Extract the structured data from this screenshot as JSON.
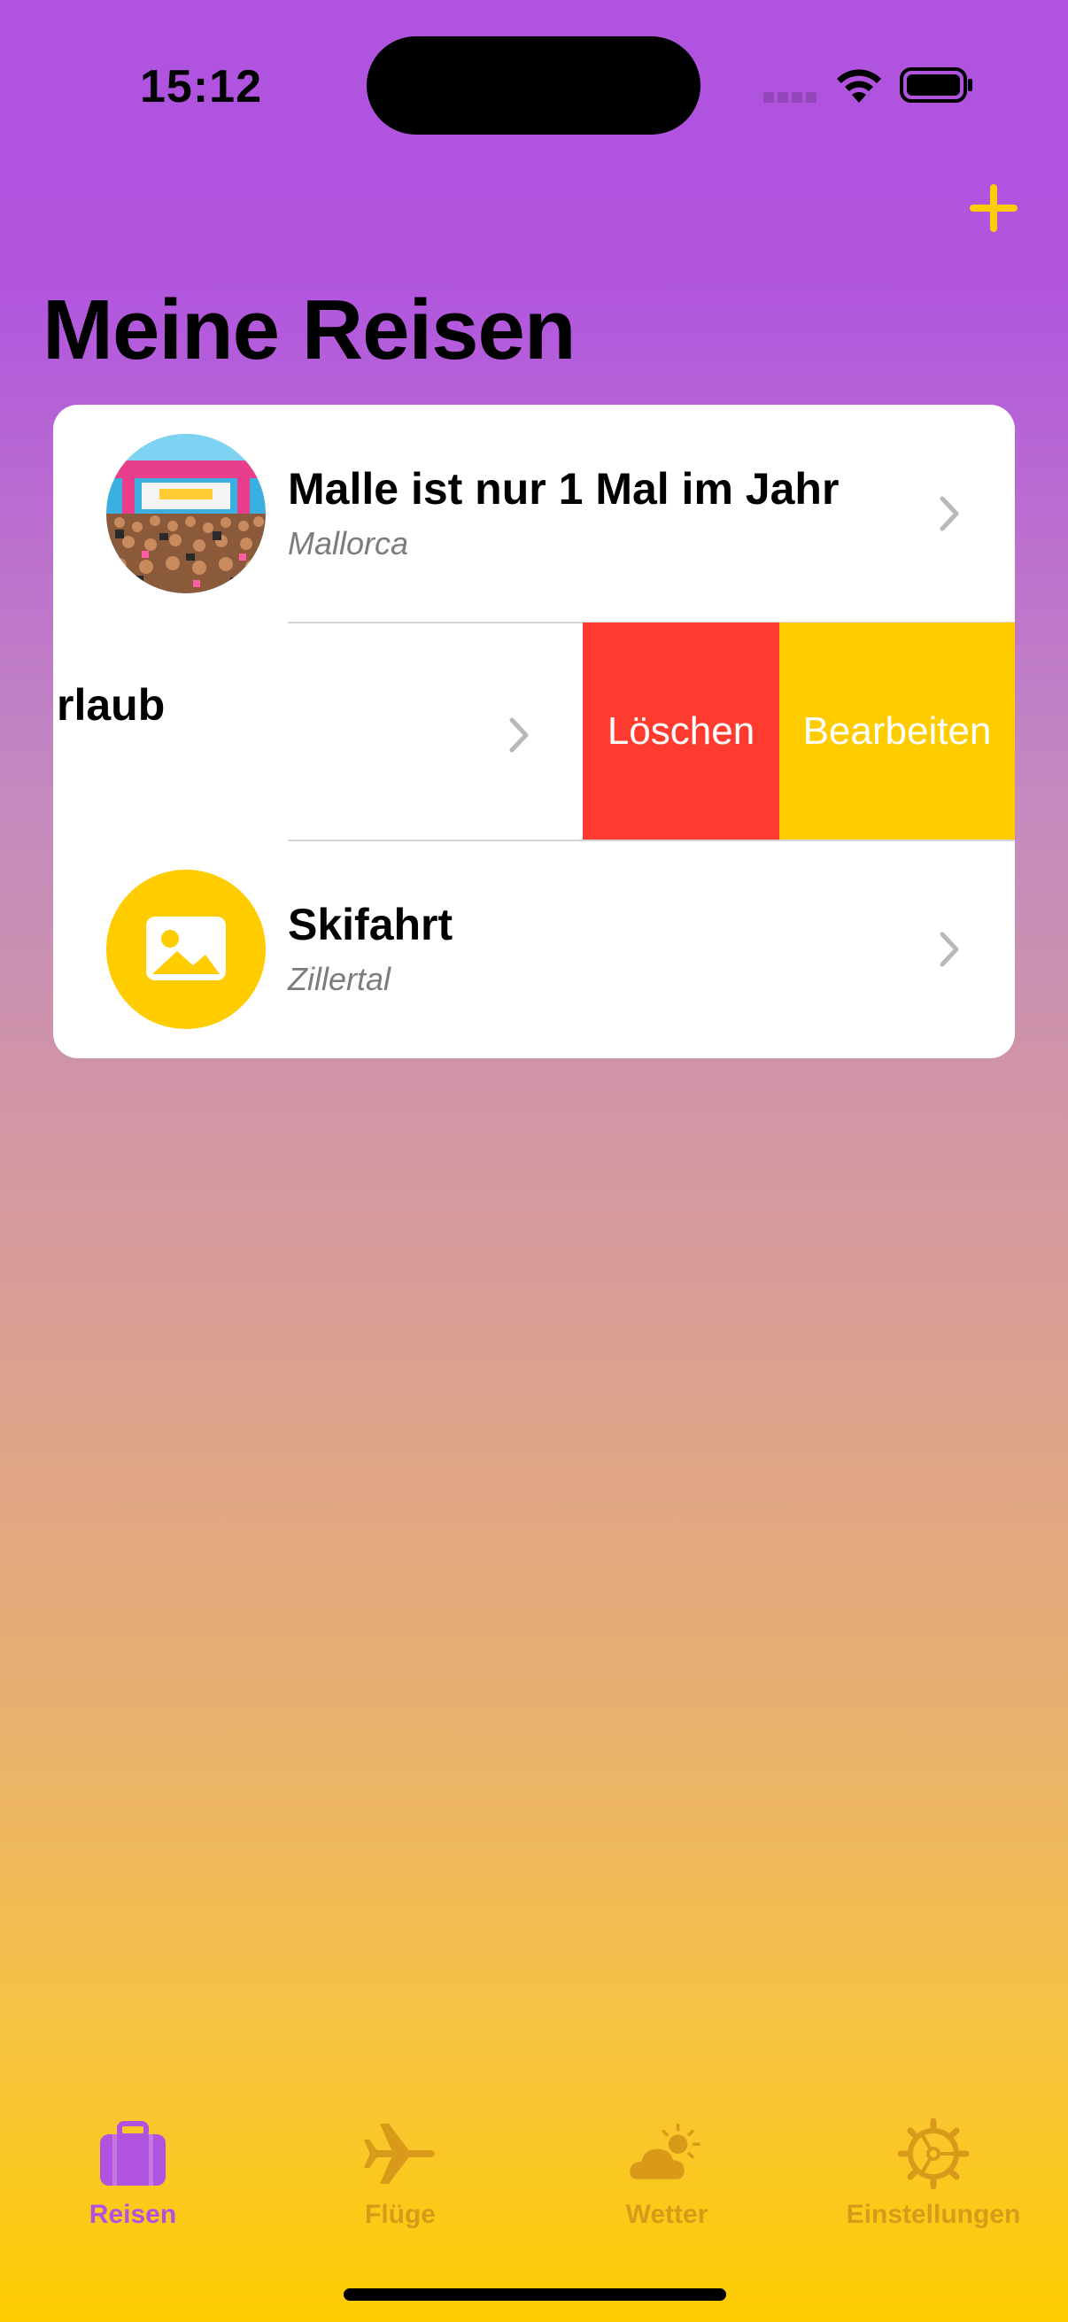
{
  "status_bar": {
    "time": "15:12"
  },
  "header": {
    "title": "Meine Reisen",
    "add_icon": "plus-icon"
  },
  "trips": [
    {
      "title": "Malle ist nur 1 Mal im Jahr",
      "subtitle": "Mallorca",
      "image": "party-crowd-photo"
    },
    {
      "title_visible": "rlaub",
      "actions": {
        "delete": "Löschen",
        "edit": "Bearbeiten"
      }
    },
    {
      "title": "Skifahrt",
      "subtitle": "Zillertal",
      "image": "image-placeholder-icon"
    }
  ],
  "tabs": [
    {
      "label": "Reisen",
      "icon": "suitcase-icon",
      "active": true
    },
    {
      "label": "Flüge",
      "icon": "airplane-icon",
      "active": false
    },
    {
      "label": "Wetter",
      "icon": "cloud-sun-icon",
      "active": false
    },
    {
      "label": "Einstellungen",
      "icon": "gear-icon",
      "active": false
    }
  ],
  "colors": {
    "accent": "#ffcc00",
    "active_tab": "#b054e0",
    "inactive_tab": "#d99a1a",
    "delete": "#ff3b30",
    "background_top": "#b054e0",
    "background_bottom": "#ffcc00"
  }
}
